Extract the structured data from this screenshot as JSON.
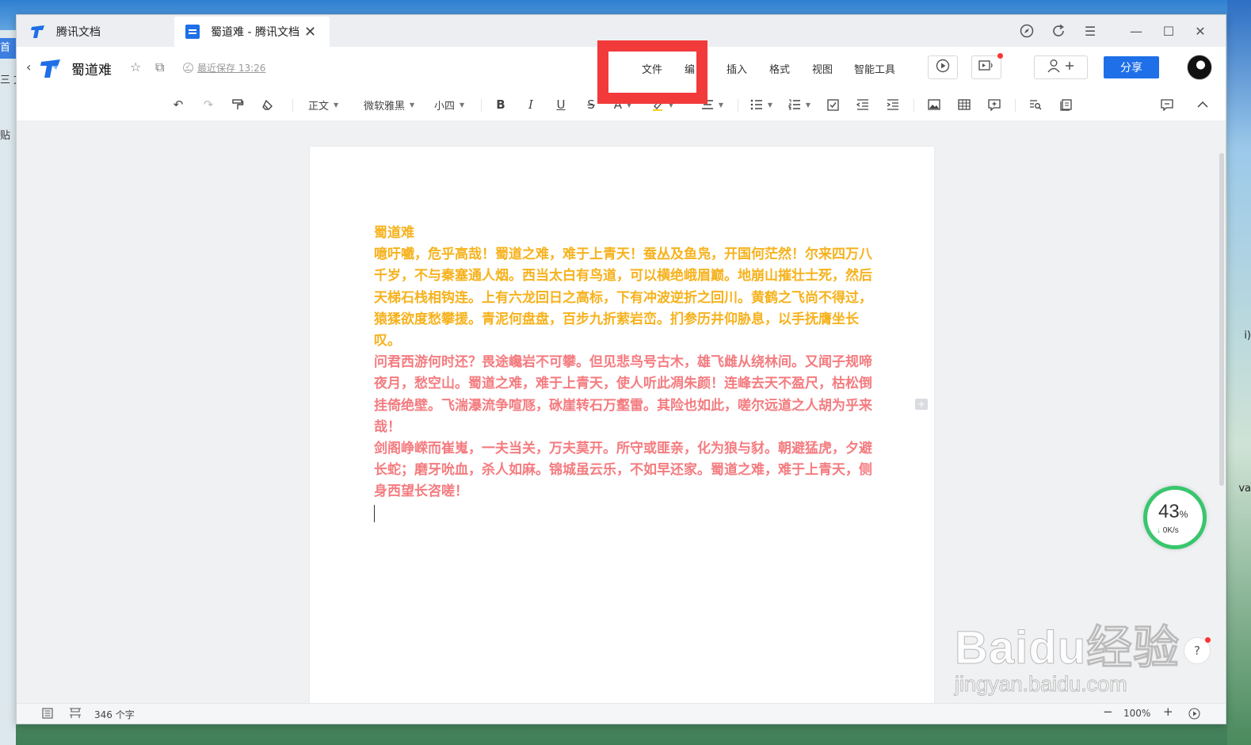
{
  "window": {
    "tabs": [
      {
        "label": "腾讯文档"
      },
      {
        "label": "蜀道难 - 腾讯文档"
      }
    ]
  },
  "header": {
    "doc_title": "蜀道难",
    "save_status": "最近保存 13:26",
    "menu": [
      "文件",
      "编",
      "插入",
      "格式",
      "视图",
      "智能工具"
    ],
    "share_label": "分享",
    "share_color": "#1e6fe8",
    "highlight_color": "#f23a3a"
  },
  "toolbar": {
    "style": "正文",
    "font": "微软雅黑",
    "size": "小四"
  },
  "document": {
    "title": "蜀道难",
    "paragraphs": [
      {
        "text": "噫吁嚱，危乎高哉！蜀道之难，难于上青天！蚕丛及鱼凫，开国何茫然！尔来四万八千岁，不与秦塞通人烟。西当太白有鸟道，可以横绝峨眉巅。地崩山摧壮士死，然后天梯石栈相钩连。上有六龙回日之高标，下有冲波逆折之回川。黄鹤之飞尚不得过，猿猱欲度愁攀援。青泥何盘盘，百步九折萦岩峦。扪参历井仰胁息，以手抚膺坐长叹。",
        "color": "#f6b21d"
      },
      {
        "text": "问君西游何时还？畏途巉岩不可攀。但见悲鸟号古木，雄飞雌从绕林间。又闻子规啼夜月，愁空山。蜀道之难，难于上青天，使人听此凋朱颜！连峰去天不盈尺，枯松倒挂倚绝壁。飞湍瀑流争喧豗，砯崖转石万壑雷。其险也如此，嗟尔远道之人胡为乎来哉！",
        "color": "#f47c80"
      },
      {
        "text": "剑阁峥嵘而崔嵬，一夫当关，万夫莫开。所守或匪亲，化为狼与豺。朝避猛虎，夕避长蛇；磨牙吮血，杀人如麻。锦城虽云乐，不如早还家。蜀道之难，难于上青天，侧身西望长咨嗟！",
        "color": "#f47c80"
      }
    ]
  },
  "statusbar": {
    "word_count": "346 个字",
    "zoom": "100%"
  },
  "overlay": {
    "speed_percent": "43",
    "speed_unit": "%",
    "speed_rate": "0K/s",
    "help": "?",
    "watermark_main": "Baidu经验",
    "watermark_sub": "jingyan.baidu.com"
  },
  "desktop": {
    "left_tag": "首页",
    "left_text1": "三 文",
    "left_text2": "贴",
    "right_text1": "i)",
    "right_text2": "va"
  }
}
